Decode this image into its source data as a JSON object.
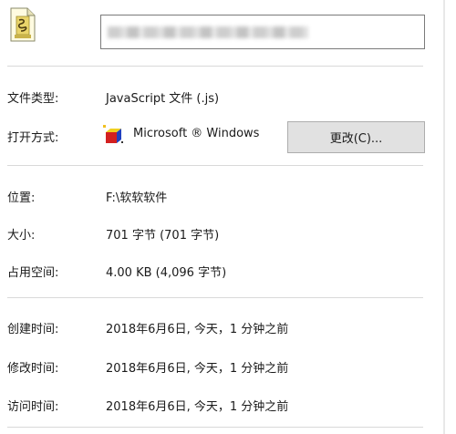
{
  "header": {
    "file_icon": "js-script-file-icon",
    "filename_value": ""
  },
  "general": {
    "file_type_label": "文件类型:",
    "file_type_value": "JavaScript 文件 (.js)",
    "opens_with_label": "打开方式:",
    "opens_with_app_icon": "windows-script-host-icon",
    "opens_with_value": "Microsoft ® Windows",
    "change_button_label": "更改(C)..."
  },
  "details": {
    "location_label": "位置:",
    "location_value": "F:\\软软软件",
    "size_label": "大小:",
    "size_value": "701 字节 (701 字节)",
    "size_on_disk_label": "占用空间:",
    "size_on_disk_value": "4.00 KB (4,096 字节)"
  },
  "timestamps": {
    "created_label": "创建时间:",
    "created_value": "2018年6月6日, 今天，1 分钟之前",
    "modified_label": "修改时间:",
    "modified_value": "2018年6月6日, 今天，1 分钟之前",
    "accessed_label": "访问时间:",
    "accessed_value": "2018年6月6日, 今天，1 分钟之前"
  }
}
